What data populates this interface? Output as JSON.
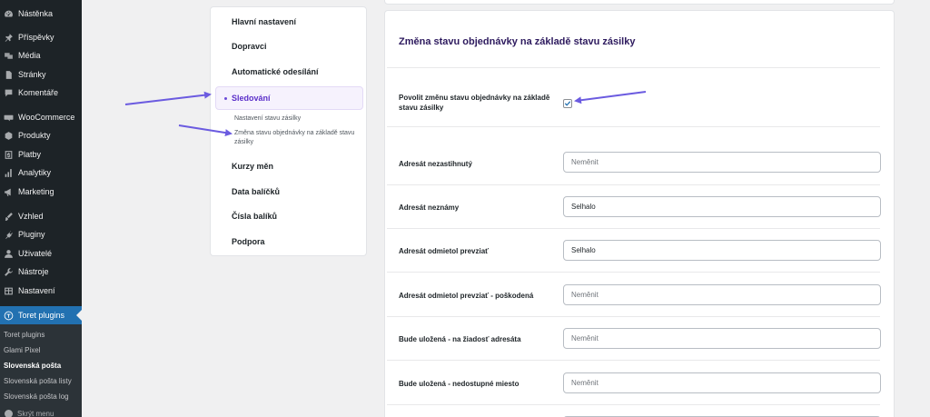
{
  "sidebar": {
    "items": [
      {
        "label": "Nástěnka",
        "icon": "dashboard-icon"
      },
      {
        "label": "Příspěvky",
        "icon": "pin-icon"
      },
      {
        "label": "Média",
        "icon": "media-icon"
      },
      {
        "label": "Stránky",
        "icon": "pages-icon"
      },
      {
        "label": "Komentáře",
        "icon": "comment-icon"
      },
      {
        "label": "WooCommerce",
        "icon": "woocommerce-icon"
      },
      {
        "label": "Produkty",
        "icon": "products-icon"
      },
      {
        "label": "Platby",
        "icon": "payments-icon"
      },
      {
        "label": "Analytiky",
        "icon": "analytics-icon"
      },
      {
        "label": "Marketing",
        "icon": "megaphone-icon"
      },
      {
        "label": "Vzhled",
        "icon": "brush-icon"
      },
      {
        "label": "Pluginy",
        "icon": "plugin-icon"
      },
      {
        "label": "Uživatelé",
        "icon": "users-icon"
      },
      {
        "label": "Nástroje",
        "icon": "wrench-icon"
      },
      {
        "label": "Nastavení",
        "icon": "settings-icon"
      }
    ],
    "current": {
      "label": "Toret plugins",
      "icon": "toret-icon"
    },
    "submenu": [
      {
        "label": "Toret plugins"
      },
      {
        "label": "Glami Pixel"
      },
      {
        "label": "Slovenská pošta"
      },
      {
        "label": "Slovenská pošta listy"
      },
      {
        "label": "Slovenská pošta log"
      }
    ],
    "collapse_label": "Skrýt menu"
  },
  "settings_nav": {
    "items": [
      "Hlavní nastavení",
      "Dopravci",
      "Automatické odesílání",
      "Sledování",
      "Kurzy měn",
      "Data balíčků",
      "Čísla balíků",
      "Podpora"
    ],
    "sub_items": [
      "Nastavení stavu zásilky",
      "Změna stavu objednávky na základě stavu zásilky"
    ]
  },
  "main": {
    "title": "Změna stavu objednávky na základě stavu zásilky",
    "checkbox": {
      "label_line1": "Povolit změnu stavu objednávky na základě",
      "label_line2": "stavu zásilky",
      "checked": true
    },
    "rows": [
      {
        "label": "Adresát nezastihnutý",
        "value": "",
        "placeholder": "Neměnit"
      },
      {
        "label": "Adresát neznámy",
        "value": "Selhalo",
        "placeholder": "Neměnit"
      },
      {
        "label": "Adresát odmietol prevziať",
        "value": "Selhalo",
        "placeholder": "Neměnit"
      },
      {
        "label": "Adresát odmietol prevziať - poškodená",
        "value": "",
        "placeholder": "Neměnit"
      },
      {
        "label": "Bude uložená - na žiadosť adresáta",
        "value": "",
        "placeholder": "Neměnit"
      },
      {
        "label": "Bude uložená - nedostupné miesto",
        "value": "",
        "placeholder": "Neměnit"
      }
    ]
  },
  "colors": {
    "sidebar_bg": "#1d2327",
    "sidebar_current": "#2271b1",
    "accent_purple": "#5b2fc9",
    "arrow": "#6b5be0"
  }
}
